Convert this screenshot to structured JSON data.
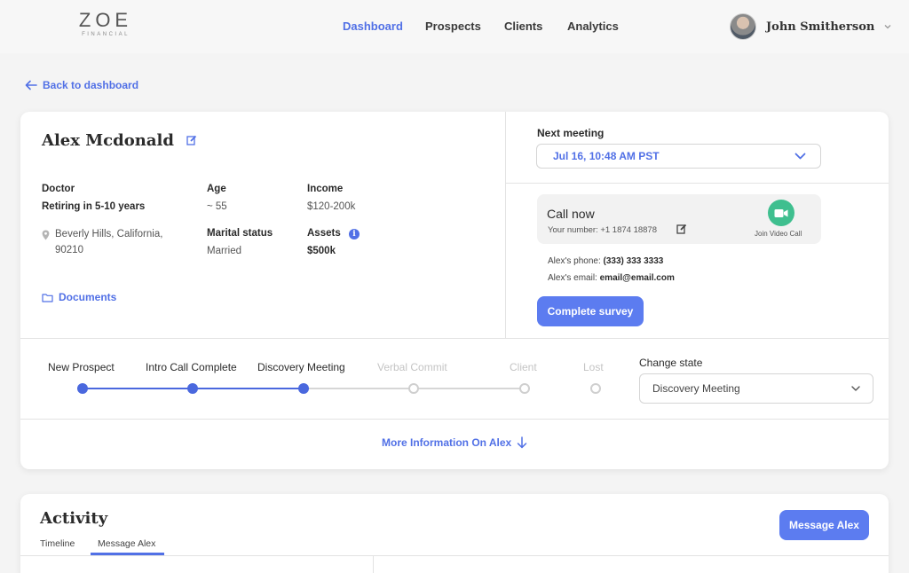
{
  "brand": {
    "name": "ZOE",
    "tagline": "FINANCIAL"
  },
  "nav": {
    "items": [
      "Dashboard",
      "Prospects",
      "Clients",
      "Analytics"
    ],
    "active": "Dashboard"
  },
  "user": {
    "name": "John Smitherson"
  },
  "back_link": "Back to dashboard",
  "client": {
    "name": "Alex Mcdonald",
    "occupation": "Doctor",
    "retirement": "Retiring in 5-10 years",
    "location": "Beverly Hills, California,",
    "zip": "90210",
    "age_label": "Age",
    "age": "~ 55",
    "marital_label": "Marital status",
    "marital": "Married",
    "income_label": "Income",
    "income": "$120-200k",
    "assets_label": "Assets",
    "assets": "$500k",
    "documents": "Documents"
  },
  "meeting": {
    "label": "Next meeting",
    "value": "Jul 16, 10:48 AM PST"
  },
  "call": {
    "title": "Call now",
    "your_number": "Your number: +1 1874 18878",
    "video_label": "Join Video Call",
    "phone_label": "Alex's phone:",
    "phone": "(333) 333 3333",
    "email_label": "Alex's email:",
    "email": "email@email.com",
    "survey_button": "Complete survey"
  },
  "pipeline": {
    "stages": [
      {
        "label": "New Prospect",
        "done": true
      },
      {
        "label": "Intro Call Complete",
        "done": true
      },
      {
        "label": "Discovery Meeting",
        "done": true
      },
      {
        "label": "Verbal Commit",
        "done": false
      },
      {
        "label": "Client",
        "done": false
      },
      {
        "label": "Lost",
        "done": false
      }
    ],
    "change_state_label": "Change state",
    "current_state": "Discovery Meeting",
    "more_info": "More Information On Alex"
  },
  "activity": {
    "title": "Activity",
    "tabs": [
      "Timeline",
      "Message Alex"
    ],
    "active_tab": "Message Alex",
    "message_button": "Message Alex"
  },
  "colors": {
    "accent": "#5170e6",
    "button": "#5c7cf0",
    "video": "#3fbf8f"
  }
}
